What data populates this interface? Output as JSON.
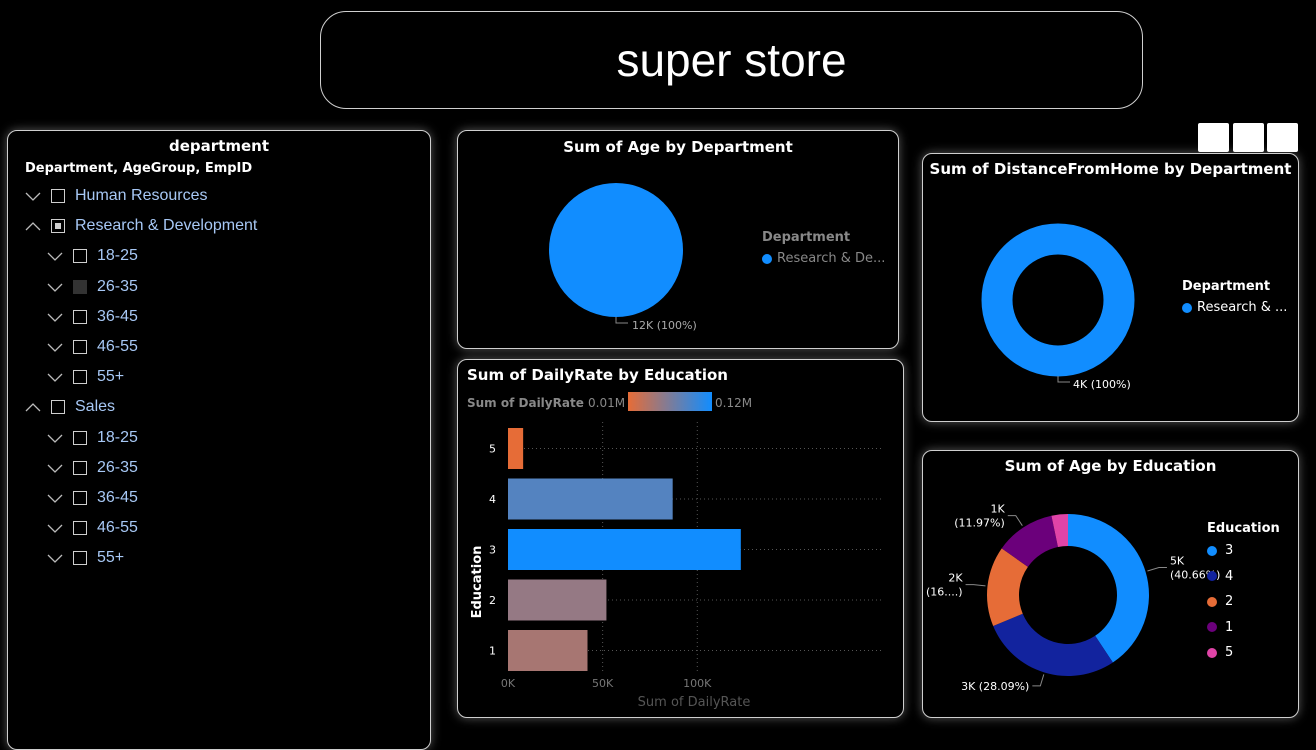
{
  "header": {
    "title": "super store"
  },
  "slicer": {
    "title": "department",
    "subtitle": "Department, AgeGroup, EmpID",
    "items": [
      {
        "label": "Human Resources",
        "level": 0,
        "expanded": false,
        "state": "unchecked"
      },
      {
        "label": "Research & Development",
        "level": 0,
        "expanded": true,
        "state": "partial"
      },
      {
        "label": "18-25",
        "level": 1,
        "expanded": false,
        "state": "unchecked"
      },
      {
        "label": "26-35",
        "level": 1,
        "expanded": false,
        "state": "dark"
      },
      {
        "label": "36-45",
        "level": 1,
        "expanded": false,
        "state": "unchecked"
      },
      {
        "label": "46-55",
        "level": 1,
        "expanded": false,
        "state": "unchecked"
      },
      {
        "label": "55+",
        "level": 1,
        "expanded": false,
        "state": "unchecked"
      },
      {
        "label": "Sales",
        "level": 0,
        "expanded": true,
        "state": "unchecked"
      },
      {
        "label": "18-25",
        "level": 1,
        "expanded": false,
        "state": "unchecked"
      },
      {
        "label": "26-35",
        "level": 1,
        "expanded": false,
        "state": "unchecked"
      },
      {
        "label": "36-45",
        "level": 1,
        "expanded": false,
        "state": "unchecked"
      },
      {
        "label": "46-55",
        "level": 1,
        "expanded": false,
        "state": "unchecked"
      },
      {
        "label": "55+",
        "level": 1,
        "expanded": false,
        "state": "unchecked"
      }
    ]
  },
  "colors": {
    "blue": "#118dff",
    "navy": "#12239e",
    "orange": "#e66c37",
    "purple": "#6b007b",
    "pink": "#e044a7"
  },
  "chart_data": [
    {
      "type": "pie",
      "title": "Sum of Age by Department",
      "legend_title": "Department",
      "legend_position": "right",
      "categories": [
        "Research & De..."
      ],
      "values": [
        12000
      ],
      "data_labels": [
        "12K (100%)"
      ]
    },
    {
      "type": "pie",
      "subtype": "donut",
      "title": "Sum of DistanceFromHome by Department",
      "legend_title": "Department",
      "legend_position": "right",
      "categories": [
        "Research & ..."
      ],
      "values": [
        4000
      ],
      "data_labels": [
        "4K (100%)"
      ]
    },
    {
      "type": "bar",
      "orientation": "horizontal",
      "title": "Sum of DailyRate by Education",
      "xlabel": "Sum of DailyRate",
      "ylabel": "Education",
      "color_legend": {
        "title": "Sum of DailyRate",
        "min_label": "0.01M",
        "max_label": "0.12M"
      },
      "categories": [
        "5",
        "4",
        "3",
        "2",
        "1"
      ],
      "values": [
        8000,
        87000,
        123000,
        52000,
        42000
      ],
      "xlim": [
        0,
        140000
      ],
      "xticks": [
        "0K",
        "50K",
        "100K"
      ],
      "grid": true
    },
    {
      "type": "pie",
      "subtype": "donut",
      "title": "Sum of Age by Education",
      "legend_title": "Education",
      "legend_position": "right",
      "legend_items": [
        "3",
        "4",
        "2",
        "1",
        "5"
      ],
      "categories": [
        "3",
        "4",
        "2",
        "1",
        "5"
      ],
      "values": [
        40.66,
        28.09,
        16.0,
        11.97,
        3.28
      ],
      "data_labels": [
        [
          "5K",
          "(40.66%)"
        ],
        [
          "3K (28.09%)"
        ],
        [
          "2K",
          "(16....)"
        ],
        [
          "1K",
          "(11.97%)"
        ],
        []
      ]
    }
  ]
}
